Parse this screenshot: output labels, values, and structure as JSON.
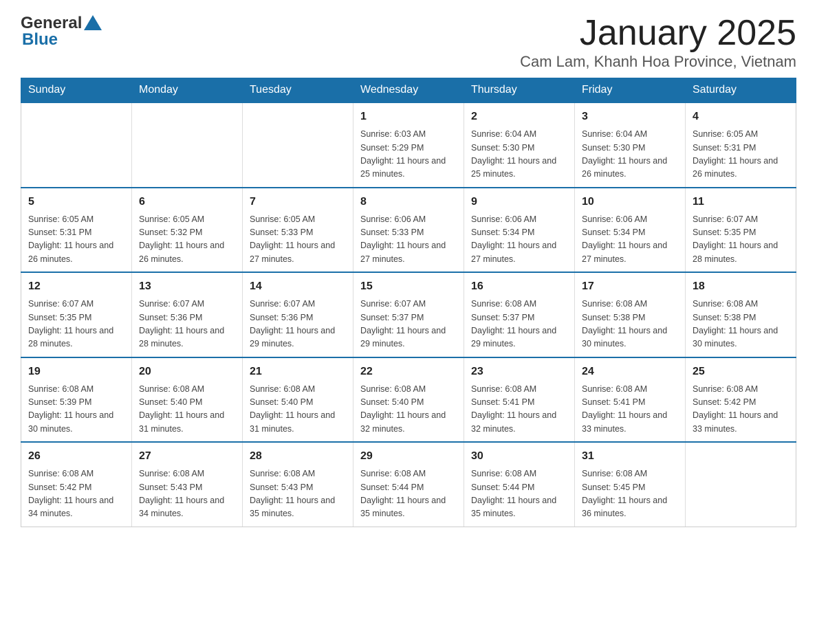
{
  "header": {
    "logo_general": "General",
    "logo_blue": "Blue",
    "title": "January 2025",
    "subtitle": "Cam Lam, Khanh Hoa Province, Vietnam"
  },
  "days_of_week": [
    "Sunday",
    "Monday",
    "Tuesday",
    "Wednesday",
    "Thursday",
    "Friday",
    "Saturday"
  ],
  "weeks": [
    [
      {
        "day": "",
        "info": ""
      },
      {
        "day": "",
        "info": ""
      },
      {
        "day": "",
        "info": ""
      },
      {
        "day": "1",
        "info": "Sunrise: 6:03 AM\nSunset: 5:29 PM\nDaylight: 11 hours and 25 minutes."
      },
      {
        "day": "2",
        "info": "Sunrise: 6:04 AM\nSunset: 5:30 PM\nDaylight: 11 hours and 25 minutes."
      },
      {
        "day": "3",
        "info": "Sunrise: 6:04 AM\nSunset: 5:30 PM\nDaylight: 11 hours and 26 minutes."
      },
      {
        "day": "4",
        "info": "Sunrise: 6:05 AM\nSunset: 5:31 PM\nDaylight: 11 hours and 26 minutes."
      }
    ],
    [
      {
        "day": "5",
        "info": "Sunrise: 6:05 AM\nSunset: 5:31 PM\nDaylight: 11 hours and 26 minutes."
      },
      {
        "day": "6",
        "info": "Sunrise: 6:05 AM\nSunset: 5:32 PM\nDaylight: 11 hours and 26 minutes."
      },
      {
        "day": "7",
        "info": "Sunrise: 6:05 AM\nSunset: 5:33 PM\nDaylight: 11 hours and 27 minutes."
      },
      {
        "day": "8",
        "info": "Sunrise: 6:06 AM\nSunset: 5:33 PM\nDaylight: 11 hours and 27 minutes."
      },
      {
        "day": "9",
        "info": "Sunrise: 6:06 AM\nSunset: 5:34 PM\nDaylight: 11 hours and 27 minutes."
      },
      {
        "day": "10",
        "info": "Sunrise: 6:06 AM\nSunset: 5:34 PM\nDaylight: 11 hours and 27 minutes."
      },
      {
        "day": "11",
        "info": "Sunrise: 6:07 AM\nSunset: 5:35 PM\nDaylight: 11 hours and 28 minutes."
      }
    ],
    [
      {
        "day": "12",
        "info": "Sunrise: 6:07 AM\nSunset: 5:35 PM\nDaylight: 11 hours and 28 minutes."
      },
      {
        "day": "13",
        "info": "Sunrise: 6:07 AM\nSunset: 5:36 PM\nDaylight: 11 hours and 28 minutes."
      },
      {
        "day": "14",
        "info": "Sunrise: 6:07 AM\nSunset: 5:36 PM\nDaylight: 11 hours and 29 minutes."
      },
      {
        "day": "15",
        "info": "Sunrise: 6:07 AM\nSunset: 5:37 PM\nDaylight: 11 hours and 29 minutes."
      },
      {
        "day": "16",
        "info": "Sunrise: 6:08 AM\nSunset: 5:37 PM\nDaylight: 11 hours and 29 minutes."
      },
      {
        "day": "17",
        "info": "Sunrise: 6:08 AM\nSunset: 5:38 PM\nDaylight: 11 hours and 30 minutes."
      },
      {
        "day": "18",
        "info": "Sunrise: 6:08 AM\nSunset: 5:38 PM\nDaylight: 11 hours and 30 minutes."
      }
    ],
    [
      {
        "day": "19",
        "info": "Sunrise: 6:08 AM\nSunset: 5:39 PM\nDaylight: 11 hours and 30 minutes."
      },
      {
        "day": "20",
        "info": "Sunrise: 6:08 AM\nSunset: 5:40 PM\nDaylight: 11 hours and 31 minutes."
      },
      {
        "day": "21",
        "info": "Sunrise: 6:08 AM\nSunset: 5:40 PM\nDaylight: 11 hours and 31 minutes."
      },
      {
        "day": "22",
        "info": "Sunrise: 6:08 AM\nSunset: 5:40 PM\nDaylight: 11 hours and 32 minutes."
      },
      {
        "day": "23",
        "info": "Sunrise: 6:08 AM\nSunset: 5:41 PM\nDaylight: 11 hours and 32 minutes."
      },
      {
        "day": "24",
        "info": "Sunrise: 6:08 AM\nSunset: 5:41 PM\nDaylight: 11 hours and 33 minutes."
      },
      {
        "day": "25",
        "info": "Sunrise: 6:08 AM\nSunset: 5:42 PM\nDaylight: 11 hours and 33 minutes."
      }
    ],
    [
      {
        "day": "26",
        "info": "Sunrise: 6:08 AM\nSunset: 5:42 PM\nDaylight: 11 hours and 34 minutes."
      },
      {
        "day": "27",
        "info": "Sunrise: 6:08 AM\nSunset: 5:43 PM\nDaylight: 11 hours and 34 minutes."
      },
      {
        "day": "28",
        "info": "Sunrise: 6:08 AM\nSunset: 5:43 PM\nDaylight: 11 hours and 35 minutes."
      },
      {
        "day": "29",
        "info": "Sunrise: 6:08 AM\nSunset: 5:44 PM\nDaylight: 11 hours and 35 minutes."
      },
      {
        "day": "30",
        "info": "Sunrise: 6:08 AM\nSunset: 5:44 PM\nDaylight: 11 hours and 35 minutes."
      },
      {
        "day": "31",
        "info": "Sunrise: 6:08 AM\nSunset: 5:45 PM\nDaylight: 11 hours and 36 minutes."
      },
      {
        "day": "",
        "info": ""
      }
    ]
  ]
}
